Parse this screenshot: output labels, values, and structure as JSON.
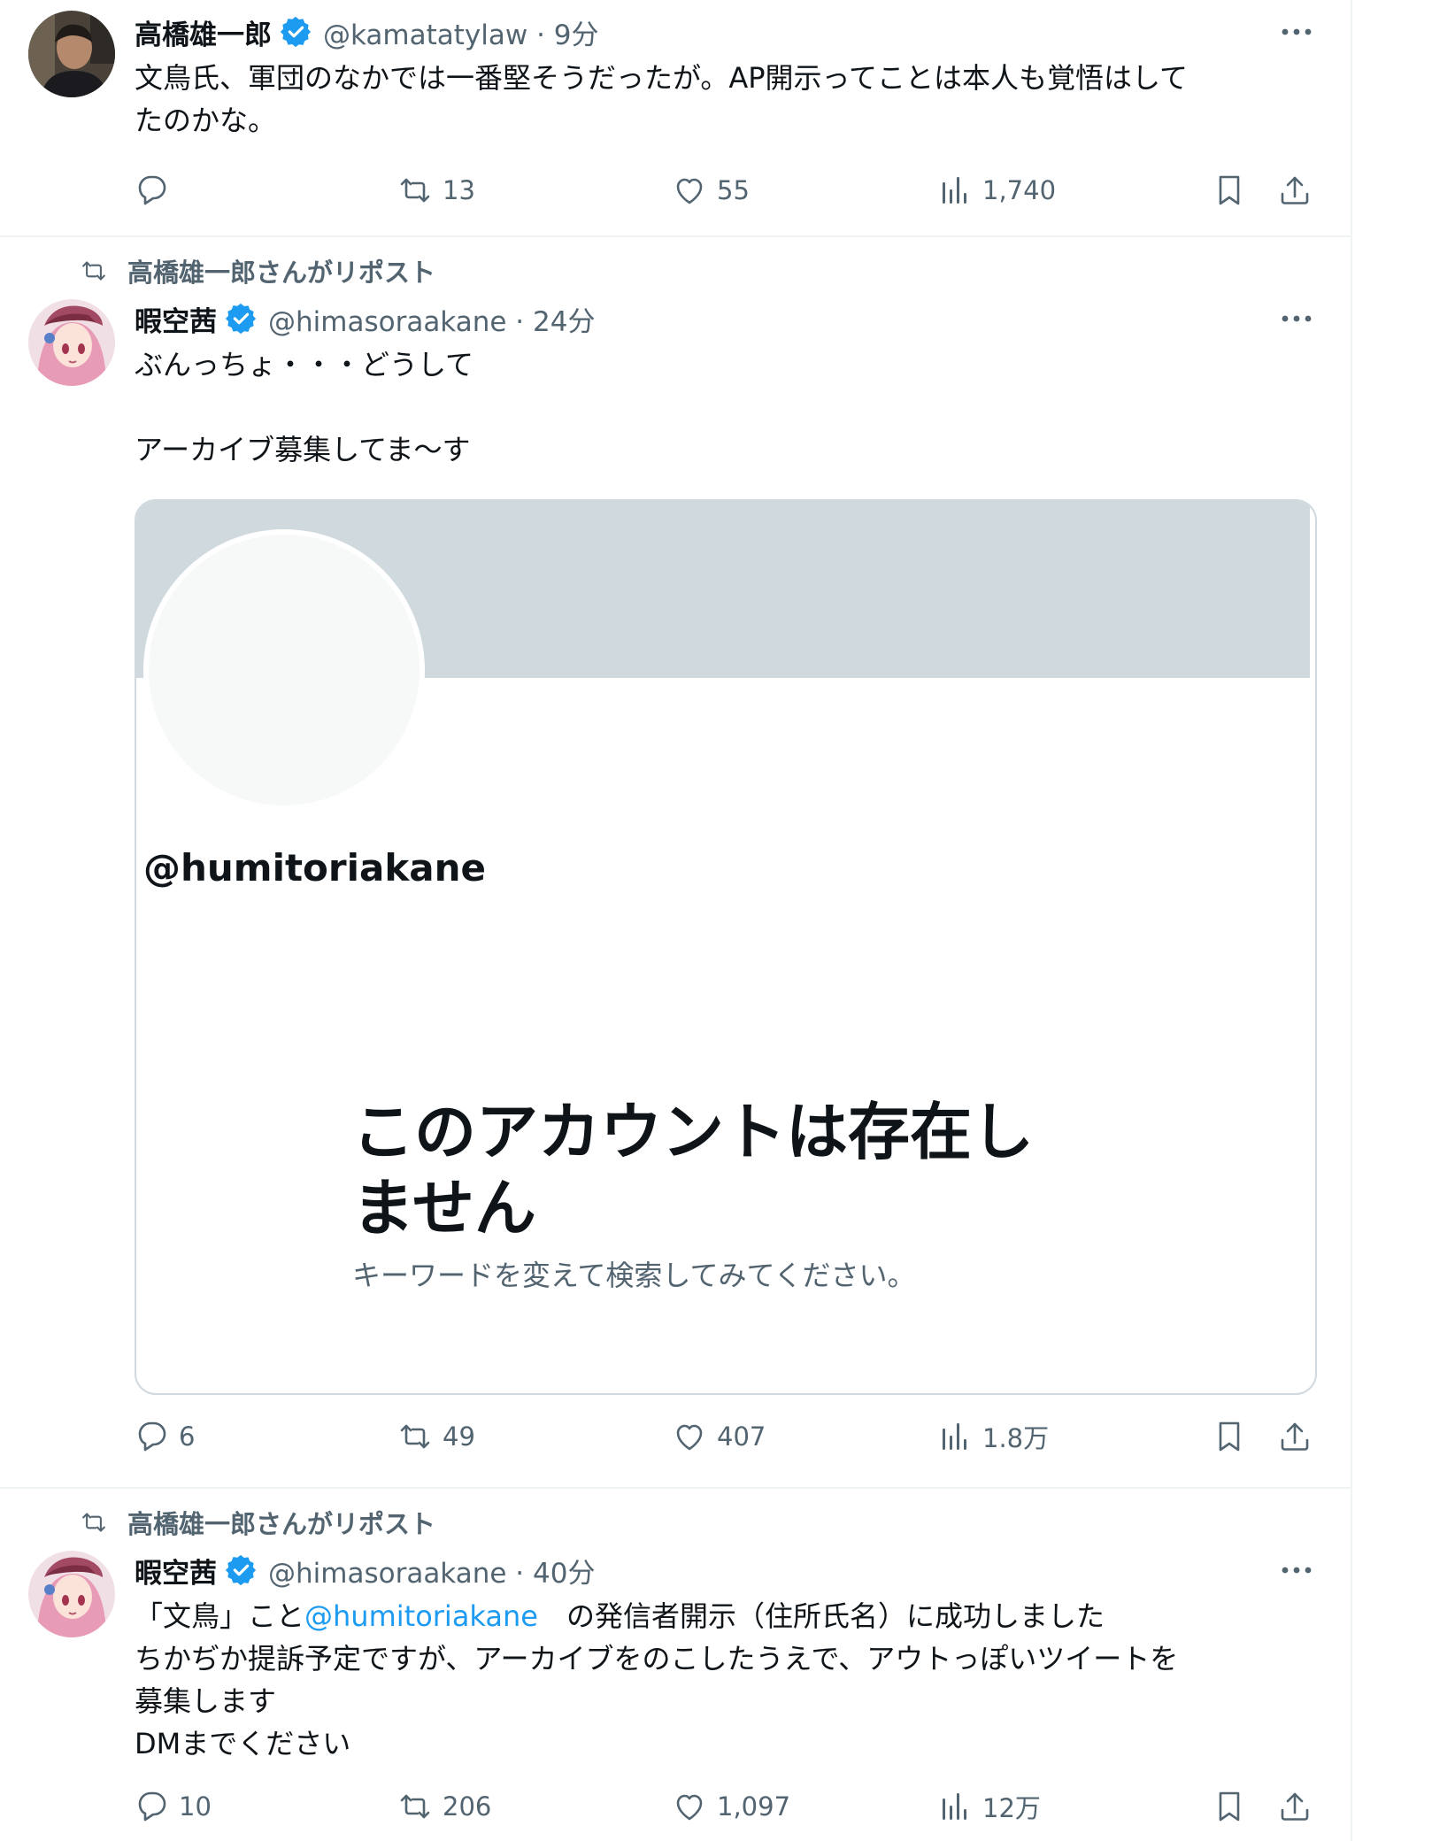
{
  "tweets": [
    {
      "author_name": "高橋雄一郎",
      "handle_time": "@kamatatylaw · 9分",
      "text_lines": [
        "文鳥氏、軍団のなかでは一番堅そうだったが。AP開示ってことは本人も覚悟はして",
        "たのかな。"
      ],
      "stats": {
        "replies": "",
        "retweets": "13",
        "likes": "55",
        "views": "1,740"
      }
    },
    {
      "retweeted_by": "高橋雄一郎さんがリポスト",
      "author_name": "暇空茜",
      "handle_time": "@himasoraakane · 24分",
      "text_lines": [
        "ぶんっちょ・・・どうして",
        "アーカイブ募集してま〜す"
      ],
      "card": {
        "handle": "@humitoriakane",
        "title": "このアカウントは存在しません",
        "subtitle": "キーワードを変えて検索してみてください。"
      },
      "stats": {
        "replies": "6",
        "retweets": "49",
        "likes": "407",
        "views": "1.8万"
      }
    },
    {
      "retweeted_by": "高橋雄一郎さんがリポスト",
      "author_name": "暇空茜",
      "handle_time": "@himasoraakane · 40分",
      "text_line1_prefix": "「文鳥」こと",
      "text_line1_link": "@humitoriakane",
      "text_line1_suffix": "　の発信者開示（住所氏名）に成功しました",
      "text_lines": [
        "ちかぢか提訴予定ですが、アーカイブをのこしたうえで、アウトっぽいツイートを",
        "募集します",
        "DMまでください"
      ],
      "stats": {
        "replies": "10",
        "retweets": "206",
        "likes": "1,097",
        "views": "12万"
      }
    }
  ],
  "icons": [
    "reply-icon",
    "retweet-icon",
    "like-icon",
    "views-icon",
    "bookmark-icon",
    "share-icon",
    "verified-badge-icon",
    "more-options-icon"
  ],
  "colors": {
    "verified": "#1d9bf0",
    "link": "#1d9bf0",
    "secondary_text": "#536471",
    "card_banner": "#cfd9de",
    "divider": "#eff3f4"
  }
}
